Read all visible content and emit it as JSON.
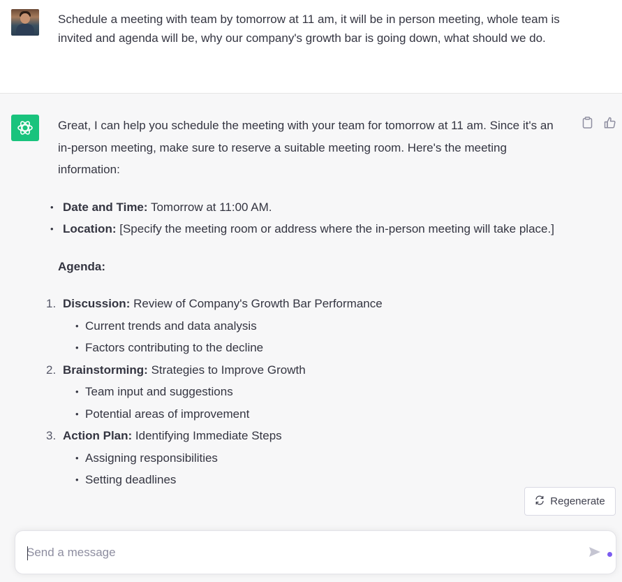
{
  "user_message": "Schedule a meeting with team by tomorrow at 11 am, it will be in person meeting, whole team is invited and agenda will be, why our company's growth bar is going down, what should we do.",
  "assistant": {
    "intro": "Great, I can help you schedule the meeting with your team for tomorrow at 11 am. Since it's an in-person meeting, make sure to reserve a suitable meeting room. Here's the meeting information:",
    "details": [
      {
        "label": "Date and Time:",
        "value": " Tomorrow at 11:00 AM."
      },
      {
        "label": "Location:",
        "value": " [Specify the meeting room or address where the in-person meeting will take place.]"
      }
    ],
    "agenda_title": "Agenda:",
    "agenda": [
      {
        "num": "1.",
        "label": "Discussion:",
        "value": " Review of Company's Growth Bar Performance",
        "items": [
          "Current trends and data analysis",
          "Factors contributing to the decline"
        ]
      },
      {
        "num": "2.",
        "label": "Brainstorming:",
        "value": " Strategies to Improve Growth",
        "items": [
          "Team input and suggestions",
          "Potential areas of improvement"
        ]
      },
      {
        "num": "3.",
        "label": "Action Plan:",
        "value": " Identifying Immediate Steps",
        "items": [
          "Assigning responsibilities",
          "Setting deadlines"
        ]
      }
    ]
  },
  "icons": {
    "user_avatar": "user-avatar",
    "assistant_avatar": "openai-logo-icon",
    "copy": "clipboard-icon",
    "feedback": "thumbs-up-icon",
    "regenerate": "refresh-icon",
    "send": "send-icon"
  },
  "colors": {
    "accent": "#19c37d",
    "status_dot": "#7b5cf0"
  },
  "regenerate_label": "Regenerate",
  "input": {
    "placeholder": "Send a message",
    "value": ""
  }
}
